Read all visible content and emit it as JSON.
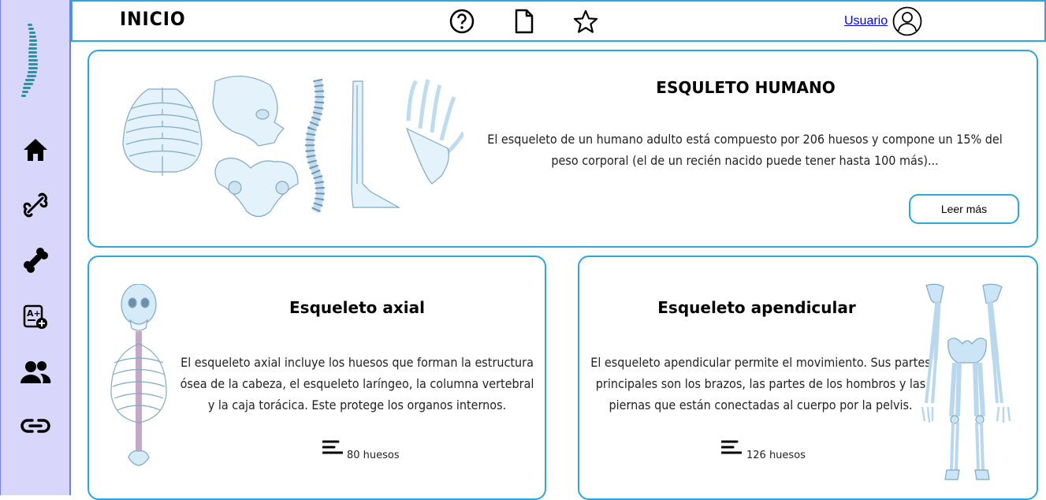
{
  "header": {
    "title": "INICIO",
    "user_label": "Usuario",
    "icons": [
      "help-icon",
      "document-icon",
      "star-icon",
      "user-avatar-icon"
    ]
  },
  "sidebar": {
    "items": [
      {
        "icon": "spine-logo-icon"
      },
      {
        "icon": "home-icon"
      },
      {
        "icon": "bone-icon"
      },
      {
        "icon": "bone-filled-icon"
      },
      {
        "icon": "add-quiz-icon"
      },
      {
        "icon": "users-icon"
      },
      {
        "icon": "link-icon"
      }
    ]
  },
  "main_card": {
    "title": "ESQULETO HUMANO",
    "text": "El esqueleto de un humano adulto está compuesto por 206 huesos y compone un 15% del peso corporal (el de un recién nacido puede tener hasta 100 más)...",
    "button": "Leer más"
  },
  "axial_card": {
    "title": "Esqueleto axial",
    "text": "El esqueleto axial incluye los huesos que forman la estructura ósea de la cabeza, el esqueleto laríngeo, la columna vertebral y la caja torácica. Este protege los organos internos.",
    "count": "80 huesos"
  },
  "apendicular_card": {
    "title": "Esqueleto apendicular",
    "text": "El esqueleto apendicular permite el movimiento. Sus partes principales son los brazos, las partes de los hombros y las piernas que están conectadas al cuerpo por la pelvis.",
    "count": "126 huesos"
  },
  "colors": {
    "accent": "#2aa6e0",
    "sidebar_bg": "#d9d6fb",
    "bone": "#cfe7f7"
  }
}
